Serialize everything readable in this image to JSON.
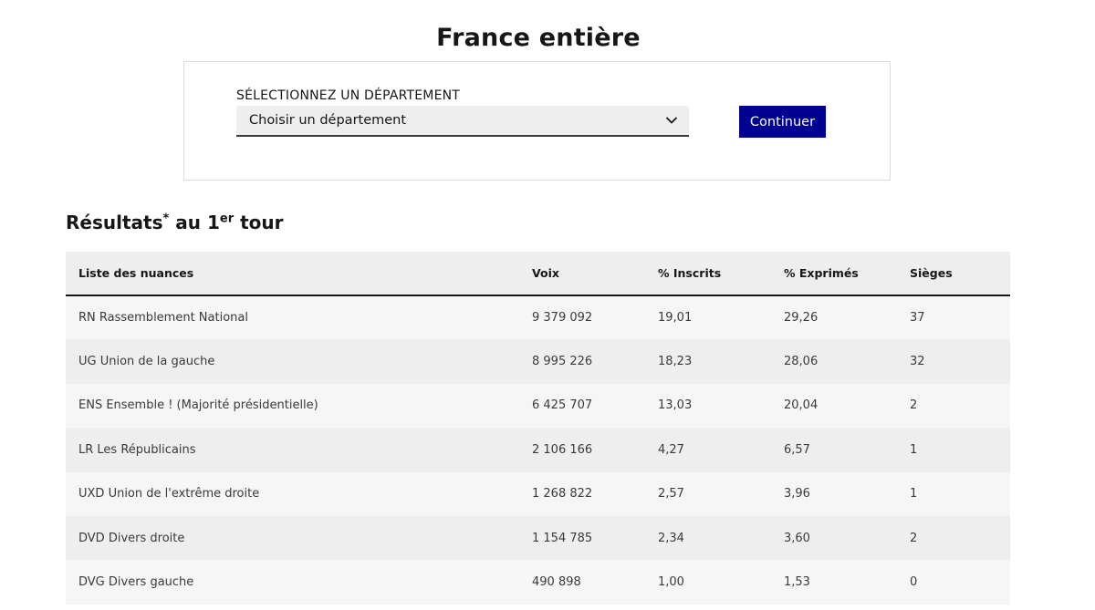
{
  "page": {
    "title": "France entière"
  },
  "selector": {
    "label": "SÉLECTIONNEZ UN DÉPARTEMENT",
    "selected_value": "Choisir un département",
    "continue_label": "Continuer"
  },
  "results": {
    "heading_main": "Résultats",
    "heading_star": "*",
    "heading_middle": " au 1",
    "heading_sup": "er",
    "heading_end": " tour",
    "columns": [
      "Liste des nuances",
      "Voix",
      "% Inscrits",
      "% Exprimés",
      "Sièges"
    ],
    "rows": [
      {
        "nuance": "RN Rassemblement National",
        "voix": "9 379 092",
        "inscrits": "19,01",
        "exprimes": "29,26",
        "sieges": "37"
      },
      {
        "nuance": "UG Union de la gauche",
        "voix": "8 995 226",
        "inscrits": "18,23",
        "exprimes": "28,06",
        "sieges": "32"
      },
      {
        "nuance": "ENS Ensemble ! (Majorité présidentielle)",
        "voix": "6 425 707",
        "inscrits": "13,03",
        "exprimes": "20,04",
        "sieges": "2"
      },
      {
        "nuance": "LR Les Républicains",
        "voix": "2 106 166",
        "inscrits": "4,27",
        "exprimes": "6,57",
        "sieges": "1"
      },
      {
        "nuance": "UXD Union de l'extrême droite",
        "voix": "1 268 822",
        "inscrits": "2,57",
        "exprimes": "3,96",
        "sieges": "1"
      },
      {
        "nuance": "DVD Divers droite",
        "voix": "1 154 785",
        "inscrits": "2,34",
        "exprimes": "3,60",
        "sieges": "2"
      },
      {
        "nuance": "DVG Divers gauche",
        "voix": "490 898",
        "inscrits": "1,00",
        "exprimes": "1,53",
        "sieges": "0"
      }
    ]
  },
  "icons": {
    "select_chevron": "chevron-down-icon"
  },
  "colors": {
    "primary": "#000091",
    "header_bg": "#eeeeee",
    "row_odd": "#f6f6f6",
    "row_even": "#eeeeee"
  }
}
